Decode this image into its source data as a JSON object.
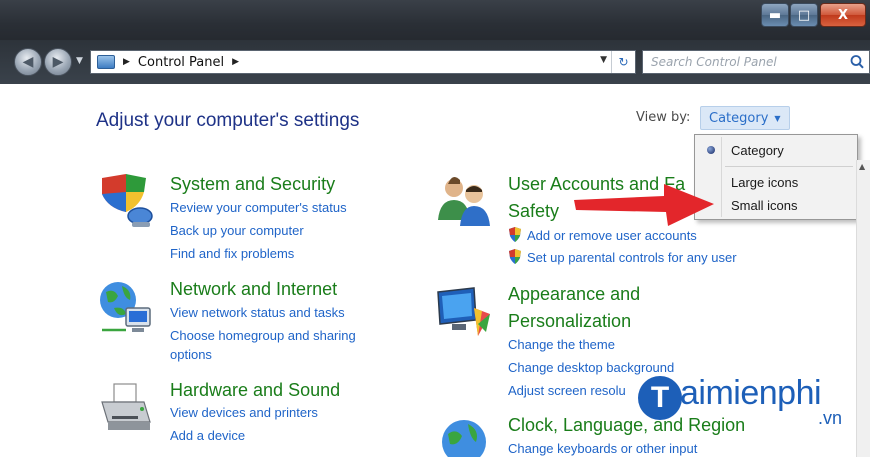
{
  "window": {
    "minimize_glyph": "▬",
    "maximize_glyph": "□",
    "close_glyph": "X"
  },
  "addressbar": {
    "path": "Control Panel",
    "search_placeholder": "Search Control Panel"
  },
  "content": {
    "heading": "Adjust your computer's settings",
    "view_by_label": "View by:",
    "view_by_value": "Category"
  },
  "view_menu": {
    "items": [
      {
        "label": "Category",
        "selected": true
      },
      {
        "label": "Large icons",
        "selected": false
      },
      {
        "label": "Small icons",
        "selected": false
      }
    ]
  },
  "categories_left": [
    {
      "title": "System and Security",
      "icon": "shield-pc-icon",
      "links": [
        "Review your computer's status",
        "Back up your computer",
        "Find and fix problems"
      ]
    },
    {
      "title": "Network and Internet",
      "icon": "network-globe-icon",
      "links": [
        "View network status and tasks",
        "Choose homegroup and sharing",
        "options"
      ]
    },
    {
      "title": "Hardware and Sound",
      "icon": "printer-icon",
      "links": [
        "View devices and printers",
        "Add a device"
      ]
    }
  ],
  "categories_right": [
    {
      "title_line1": "User Accounts and Fa",
      "title_line2": "Safety",
      "icon": "users-icon",
      "links": [
        "Add or remove user accounts",
        "Set up parental controls for any user"
      ]
    },
    {
      "title_line1": "Appearance and",
      "title_line2": "Personalization",
      "icon": "display-icon",
      "links": [
        "Change the theme",
        "Change desktop background",
        "Adjust screen resolu"
      ]
    },
    {
      "title_line1": "Clock, Language, and Region",
      "icon": "globe-clock-icon",
      "links": [
        "Change keyboards or other input"
      ]
    }
  ],
  "watermark": {
    "logo_letter": "T",
    "text": "aimienphi",
    "suffix": ".vn"
  },
  "colors": {
    "category_title": "#1a7d1a",
    "link": "#1f64c8",
    "heading": "#1e3287",
    "annotation_arrow": "#e3262b"
  }
}
